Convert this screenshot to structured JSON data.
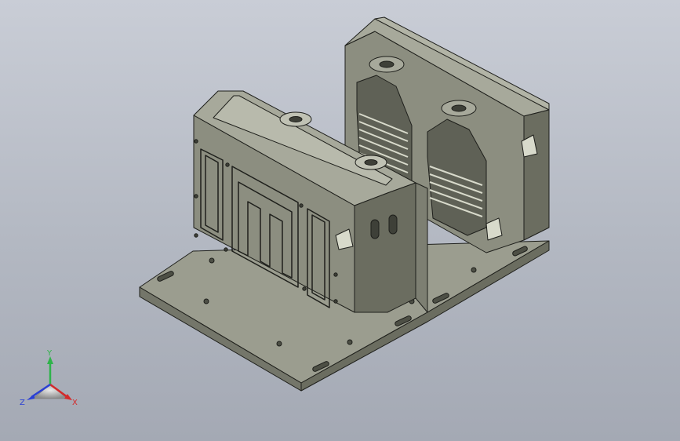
{
  "triad": {
    "x_label": "X",
    "y_label": "Y",
    "z_label": "Z",
    "x_color": "#d42a2a",
    "y_color": "#2fb34a",
    "z_color": "#2a3fd4"
  },
  "model": {
    "body_color": "#8c8e80",
    "light_face": "#a7a99b",
    "dark_face": "#6b6d60",
    "edge_color": "#1e1f1b"
  }
}
